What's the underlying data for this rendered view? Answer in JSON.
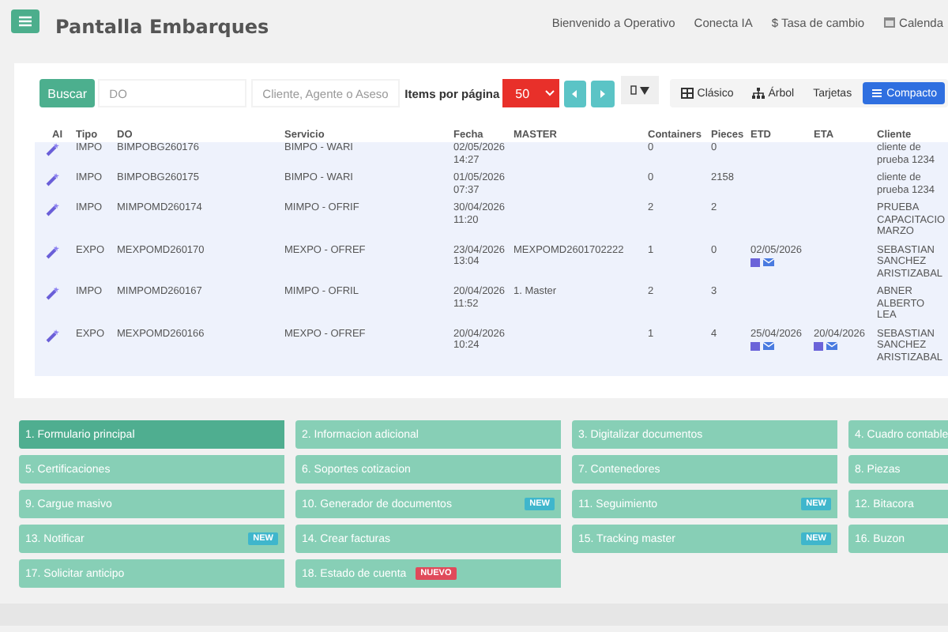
{
  "header": {
    "title": "Pantalla Embarques",
    "nav": [
      "Bienvenido a Operativo",
      "Conecta IA",
      "$ Tasa de cambio",
      "Calenda"
    ]
  },
  "toolbar": {
    "search_button": "Buscar",
    "do_field": {
      "placeholder": "DO"
    },
    "client_field": {
      "placeholder": "Cliente, Agente o Aseso"
    },
    "page_size_label": "Items por página",
    "page_size": "50",
    "views": [
      {
        "label": "Clásico",
        "selected": false
      },
      {
        "label": "Árbol",
        "selected": false
      },
      {
        "label": "Tarjetas",
        "selected": false
      },
      {
        "label": "Compacto",
        "selected": true
      }
    ]
  },
  "table": {
    "columns": [
      "AI",
      "Tipo",
      "DO",
      "Servicio",
      "Fecha",
      "MASTER",
      "Containers",
      "Pieces",
      "ETD",
      "ETA",
      "Cliente"
    ],
    "rows": [
      {
        "tipo": "IMPO",
        "do": "BIMPOBG260176",
        "servicio": "BIMPO - WARI",
        "fecha": [
          "02/05/2026",
          "14:27"
        ],
        "master": "",
        "containers": "0",
        "pieces": "0",
        "etd": "",
        "eta": "",
        "cliente": "cliente de prueba 1234"
      },
      {
        "tipo": "IMPO",
        "do": "BIMPOBG260175",
        "servicio": "BIMPO - WARI",
        "fecha": [
          "01/05/2026",
          "07:37"
        ],
        "master": "",
        "containers": "0",
        "pieces": "2158",
        "etd": "",
        "eta": "",
        "cliente": "cliente de prueba 1234"
      },
      {
        "tipo": "IMPO",
        "do": "MIMPOMD260174",
        "servicio": "MIMPO - OFRIF",
        "fecha": [
          "30/04/2026",
          "11:20"
        ],
        "master": "",
        "containers": "2",
        "pieces": "2",
        "etd": "",
        "eta": "",
        "cliente": "PRUEBA CAPACITACIO MARZO"
      },
      {
        "tipo": "EXPO",
        "do": "MEXPOMD260170",
        "servicio": "MEXPO - OFREF",
        "fecha": [
          "23/04/2026",
          "13:04"
        ],
        "master": "MEXPOMD2601702222",
        "containers": "1",
        "pieces": "0",
        "etd": "02/05/2026",
        "eta": "",
        "cliente": "SEBASTIAN SANCHEZ ARISTIZABAL"
      },
      {
        "tipo": "IMPO",
        "do": "MIMPOMD260167",
        "servicio": "MIMPO - OFRIL",
        "fecha": [
          "20/04/2026",
          "11:52"
        ],
        "master": "1. Master",
        "containers": "2",
        "pieces": "3",
        "etd": "",
        "eta": "",
        "cliente": "ABNER ALBERTO LEA"
      },
      {
        "tipo": "EXPO",
        "do": "MEXPOMD260166",
        "servicio": "MEXPO - OFREF",
        "fecha": [
          "20/04/2026",
          "10:24"
        ],
        "master": "",
        "containers": "1",
        "pieces": "4",
        "etd": "25/04/2026",
        "eta": "20/04/2026",
        "cliente": "SEBASTIAN SANCHEZ ARISTIZABAL"
      }
    ]
  },
  "menu": [
    {
      "label": "1. Formulario principal",
      "selected": true
    },
    {
      "label": "2. Informacion adicional",
      "selected": false
    },
    {
      "label": "3. Digitalizar documentos",
      "selected": false
    },
    {
      "label": "4. Cuadro contable",
      "selected": false
    },
    {
      "label": "5. Certificaciones",
      "selected": false
    },
    {
      "label": "6. Soportes cotizacion",
      "selected": false
    },
    {
      "label": "7. Contenedores",
      "selected": false
    },
    {
      "label": "8. Piezas",
      "selected": false
    },
    {
      "label": "9. Cargue masivo",
      "selected": false
    },
    {
      "label": "10. Generador de documentos",
      "selected": false,
      "badge": {
        "text": "NEW",
        "kind": "new"
      }
    },
    {
      "label": "11. Seguimiento",
      "selected": false,
      "badge": {
        "text": "NEW",
        "kind": "new"
      }
    },
    {
      "label": "12. Bitacora",
      "selected": false
    },
    {
      "label": "13. Notificar",
      "selected": false,
      "badge": {
        "text": "NEW",
        "kind": "new"
      }
    },
    {
      "label": "14. Crear facturas",
      "selected": false
    },
    {
      "label": "15. Tracking master",
      "selected": false,
      "badge": {
        "text": "NEW",
        "kind": "new"
      }
    },
    {
      "label": "16. Buzon",
      "selected": false
    },
    {
      "label": "17. Solicitar anticipo",
      "selected": false
    },
    {
      "label": "18. Estado de cuenta",
      "selected": false,
      "badge": {
        "text": "NUEVO",
        "kind": "nuevo"
      }
    }
  ]
}
